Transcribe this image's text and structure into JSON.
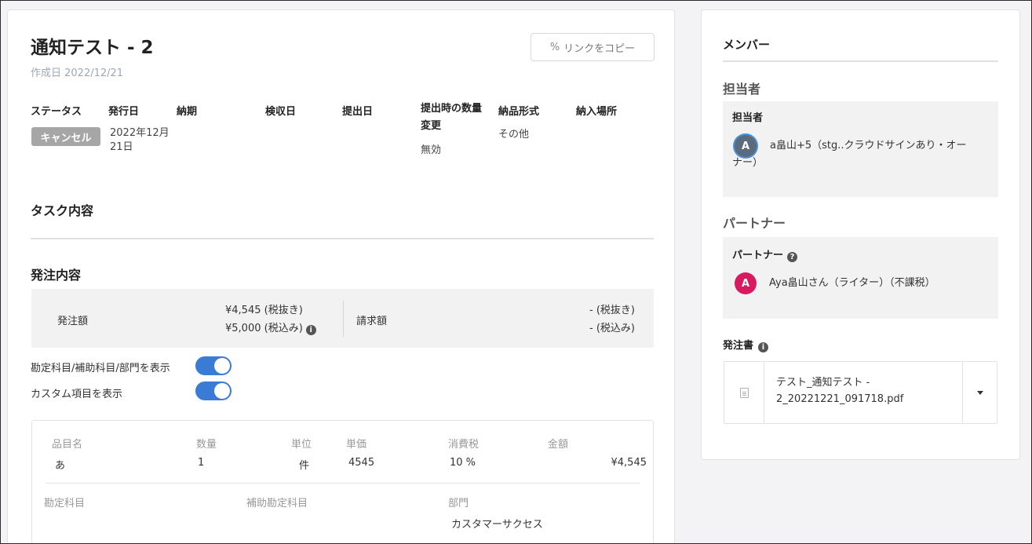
{
  "task": {
    "title": "通知テスト - 2",
    "created": "作成日 2022/12/21",
    "copy_link_label": "リンクをコピー"
  },
  "meta": {
    "headers": {
      "status": "ステータス",
      "issue_date": "発行日",
      "due_date": "納期",
      "inspection_date": "検収日",
      "submission_date": "提出日",
      "qty_change_1": "提出時の数量",
      "qty_change_2": "変更",
      "delivery_format": "納品形式",
      "delivery_place": "納入場所"
    },
    "values": {
      "status_badge": "キャンセル",
      "issue_date_1": "2022年12月",
      "issue_date_2": "21日",
      "qty_change": "無効",
      "delivery_format": "その他"
    }
  },
  "sections": {
    "task_content": "タスク内容",
    "order_content": "発注内容"
  },
  "amounts": {
    "order_label": "発注額",
    "order_ex_tax": "¥4,545 (税抜き)",
    "order_in_tax": "¥5,000 (税込み)",
    "invoice_label": "請求額",
    "invoice_ex_tax": "- (税抜き)",
    "invoice_in_tax": "- (税込み)"
  },
  "toggles": {
    "account_label": "勘定科目/補助科目/部門を表示",
    "custom_label": "カスタム項目を表示",
    "account_on": true,
    "custom_on": true
  },
  "items": {
    "headers": {
      "name": "品目名",
      "qty": "数量",
      "unit": "単位",
      "price": "単価",
      "tax": "消費税",
      "amount": "金額"
    },
    "row": {
      "name": "あ",
      "qty": "1",
      "unit": "件",
      "price": "4545",
      "tax": "10 %",
      "amount": "¥4,545"
    },
    "accounts": {
      "account_label": "勘定科目",
      "sub_account_label": "補助勘定科目",
      "department_label": "部門",
      "department_value": "カスタマーサクセス"
    }
  },
  "sidebar": {
    "title": "メンバー",
    "assignee_section": "担当者",
    "assignee_box_title": "担当者",
    "assignee_initial": "A",
    "assignee_name_1": "a畠山+5（stg..クラウドサインあり・オー",
    "assignee_name_2": "ナー）",
    "partner_section": "パートナー",
    "partner_box_title": "パートナー",
    "partner_initial": "A",
    "partner_name": "Aya畠山さん（ライター）（不課税）",
    "order_doc_label": "発注書",
    "file_name_1": "テスト_通知テスト -",
    "file_name_2": "2_20221221_091718.pdf"
  },
  "colors": {
    "accent": "#3a7bd5",
    "badge_gray": "#a6a6a6",
    "partner_avatar": "#d81b60"
  }
}
